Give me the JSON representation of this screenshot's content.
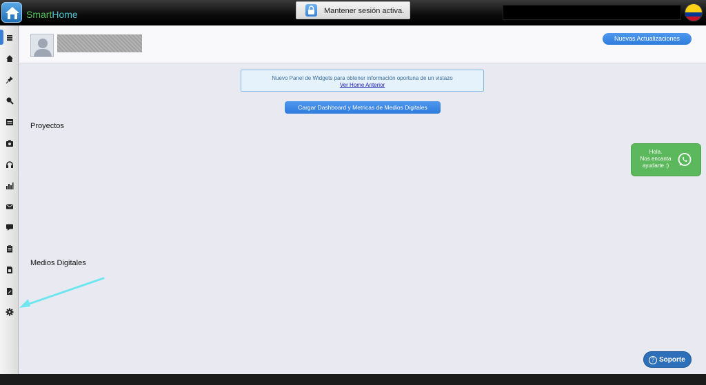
{
  "app": {
    "brand_part1": "Smart",
    "brand_part2": "Home"
  },
  "session": {
    "label": "Mantener sesión activa."
  },
  "header": {
    "updates_label": "Nuevas Actualizaciones"
  },
  "notice": {
    "line1": "Nuevo Panel de Widgets para obtener información oportuna de un vistazo",
    "link": "Ver Home Anterior"
  },
  "dashboard": {
    "load_label": "Cargar Dashboard y Metricas de Medios Digitales"
  },
  "sections": {
    "proyectos": "Proyectos",
    "medios": "Medios Digitales"
  },
  "whatsapp": {
    "line1": "Hola.",
    "line2": "Nos encanta",
    "line3": "ayudarte :)"
  },
  "support": {
    "label": "Soporte",
    "icon_glyph": "?"
  },
  "sidebar": {
    "icons": [
      "menu-icon",
      "home-icon",
      "pin-icon",
      "search-icon",
      "calendar-icon",
      "camera-icon",
      "headset-icon",
      "bar-chart-icon",
      "mail-icon",
      "chat-icon",
      "clipboard-icon",
      "document-icon",
      "edit-document-icon",
      "gear-icon"
    ]
  },
  "colors": {
    "accent": "#3c7fd6",
    "whatsapp": "#5cb85c",
    "support": "#2d6fb8",
    "arrow": "#6fe6ef"
  }
}
